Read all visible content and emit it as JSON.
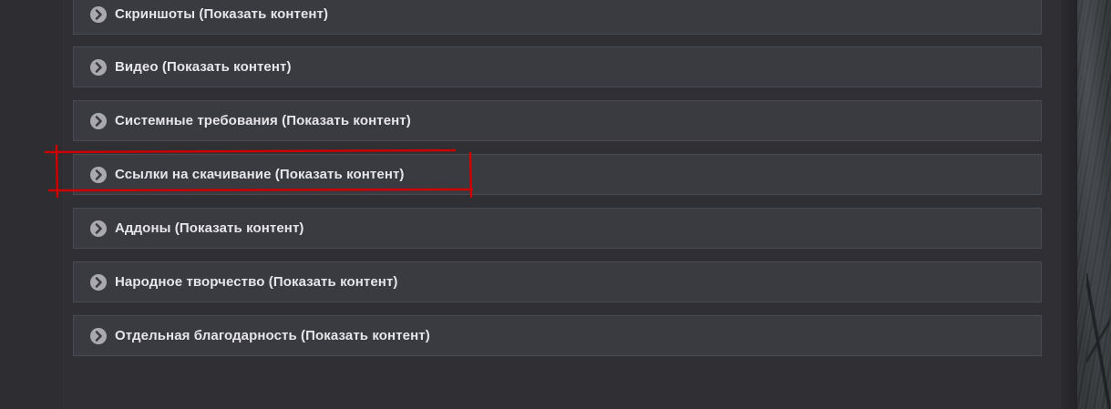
{
  "spoilers": [
    {
      "label": "Скриншоты (Показать контент)"
    },
    {
      "label": "Видео (Показать контент)"
    },
    {
      "label": "Системные требования (Показать контент)"
    },
    {
      "label": "Ссылки на скачивание (Показать контент)"
    },
    {
      "label": "Аддоны (Показать контент)"
    },
    {
      "label": "Народное творчество (Показать контент)"
    },
    {
      "label": "Отдельная благодарность (Показать контент)"
    }
  ],
  "icons": {
    "toggle": "chevron-right-circle-icon"
  },
  "colors": {
    "panel": "#3a3a41",
    "panel_border": "#4a4a52",
    "text": "#e6e6e9",
    "icon_bg": "#a9a9ad",
    "highlight": "#cc0000"
  }
}
